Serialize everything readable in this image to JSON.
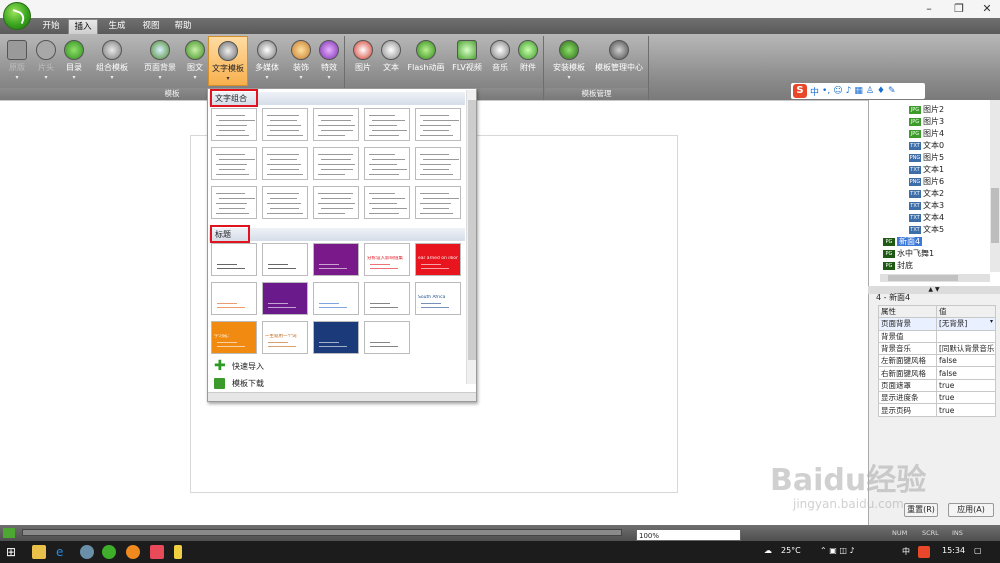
{
  "window": {
    "min": "–",
    "max": "❐",
    "close": "✕"
  },
  "menu": [
    "开始",
    "插入",
    "生成",
    "视图",
    "帮助"
  ],
  "ribbon": {
    "group1": {
      "label": "模板",
      "buttons": [
        "原版",
        "片头",
        "目录",
        "组合模板",
        "页面背景",
        "图文",
        "文字模板",
        "多媒体",
        "装饰",
        "特效"
      ]
    },
    "group2": {
      "buttons": [
        "图片",
        "文本",
        "Flash动画",
        "FLV视频",
        "音乐",
        "附件"
      ]
    },
    "group3": {
      "label": "模板管理",
      "buttons": [
        "安装模板",
        "模板管理中心"
      ]
    }
  },
  "ime": {
    "logo": "S",
    "mode": "中"
  },
  "dropdown": {
    "section1": "文字组合",
    "section2": "标题",
    "title_thumbs": [
      "",
      "",
      "",
      "分拆设入影响值集",
      "ear arned on illion of",
      "",
      "",
      "",
      "",
      "South Africa",
      "学习成：",
      "一生就用一个词",
      "",
      "",
      ""
    ],
    "actions": [
      "快速导入",
      "模板下载"
    ]
  },
  "tree": {
    "items": [
      "图片2",
      "图片3",
      "图片4",
      "文本0",
      "图片5",
      "文本1",
      "图片6",
      "文本2",
      "文本3",
      "文本4",
      "文本5"
    ],
    "pages": [
      "新面4",
      "水中飞舞1",
      "封底"
    ]
  },
  "props": {
    "title": "4 - 新面4",
    "head": [
      "属性",
      "值"
    ],
    "rows": [
      [
        "页面背景",
        "[无背景]"
      ],
      [
        "背景值",
        ""
      ],
      [
        "背景音乐",
        "[同默认背景音乐]"
      ],
      [
        "左新面键风格",
        "false"
      ],
      [
        "右新面键风格",
        "false"
      ],
      [
        "页面遮罩",
        "true"
      ],
      [
        "显示进度条",
        "true"
      ],
      [
        "显示页码",
        "true"
      ]
    ],
    "reset": "重置(R)",
    "apply": "应用(A)"
  },
  "status": {
    "zoom": "100%",
    "locks": [
      "NUM",
      "SCRL",
      "INS"
    ]
  },
  "taskbar": {
    "weather": "25°C",
    "ime": "中",
    "time": "15:34"
  },
  "watermark": {
    "brand": "Baidu经验",
    "url": "jingyan.baidu.com"
  },
  "colors": {
    "accent_active": "#f7b04e",
    "highlight_box": "#e0141e",
    "tree_selected": "#3c78d8"
  }
}
